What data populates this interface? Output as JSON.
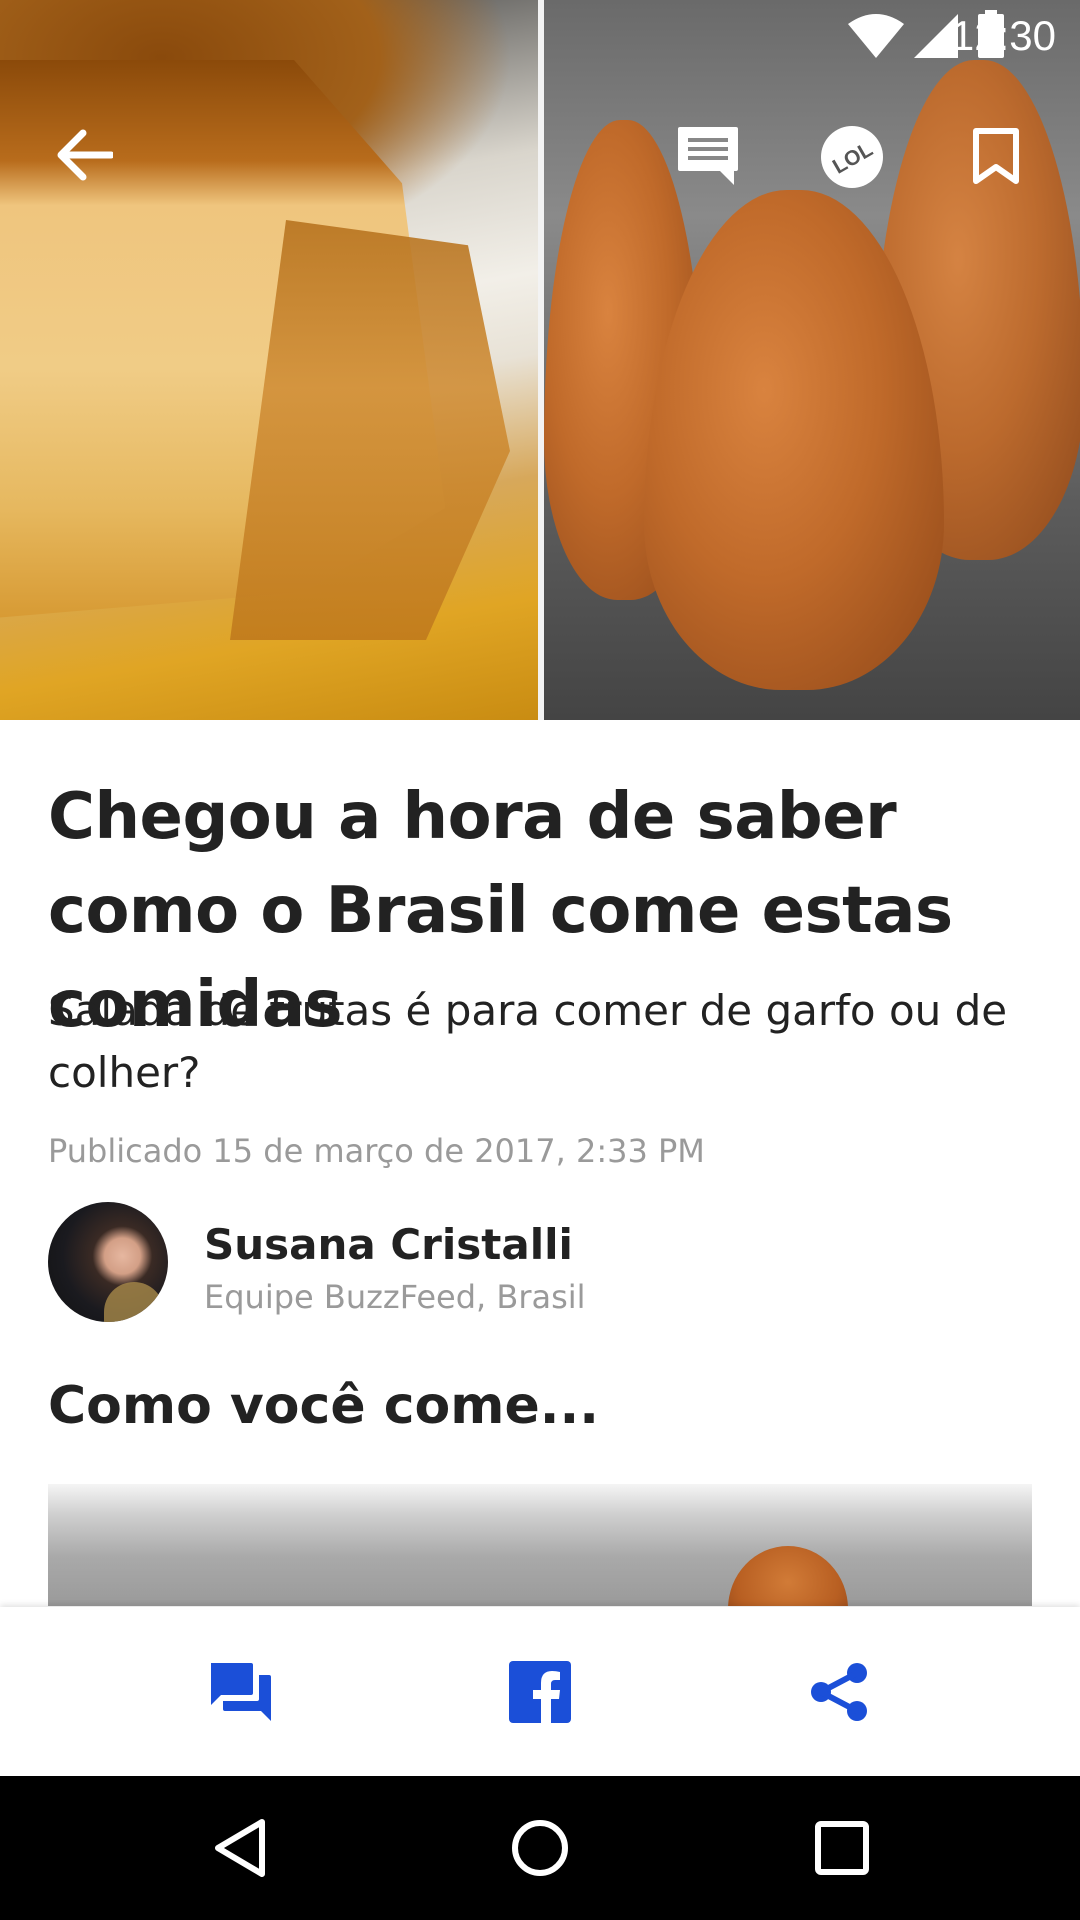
{
  "status_bar": {
    "time": "12:30",
    "icons": [
      "wifi-icon",
      "cell-signal-icon",
      "battery-icon"
    ]
  },
  "toolbar": {
    "back_icon": "arrow-left-icon",
    "comments_icon": "comment-icon",
    "reaction_label": "LOL",
    "bookmark_icon": "bookmark-icon"
  },
  "article": {
    "title": "Chegou a hora de saber como o Brasil come estas comidas",
    "subtitle": "Salada de frutas é para comer de garfo ou de colher?",
    "published": "Publicado 15 de março de 2017, 2:33 PM",
    "author": {
      "name": "Susana Cristalli",
      "team": "Equipe BuzzFeed, Brasil"
    },
    "section_heading": "Como você come..."
  },
  "action_bar": {
    "accent_color": "#1b4fd8",
    "buttons": [
      "chat-icon",
      "facebook-icon",
      "share-icon"
    ]
  },
  "nav_bar": {
    "buttons": [
      "back-triangle-icon",
      "home-circle-icon",
      "recents-square-icon"
    ]
  }
}
